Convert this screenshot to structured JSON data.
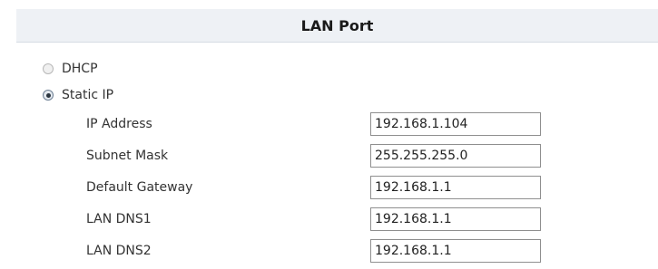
{
  "header": {
    "title": "LAN Port"
  },
  "mode": {
    "dhcp_label": "DHCP",
    "static_label": "Static IP",
    "selected": "Static IP"
  },
  "fields": [
    {
      "label": "IP Address",
      "value": "192.168.1.104"
    },
    {
      "label": "Subnet Mask",
      "value": "255.255.255.0"
    },
    {
      "label": "Default Gateway",
      "value": "192.168.1.1"
    },
    {
      "label": "LAN DNS1",
      "value": "192.168.1.1"
    },
    {
      "label": "LAN DNS2",
      "value": "192.168.1.1"
    }
  ]
}
